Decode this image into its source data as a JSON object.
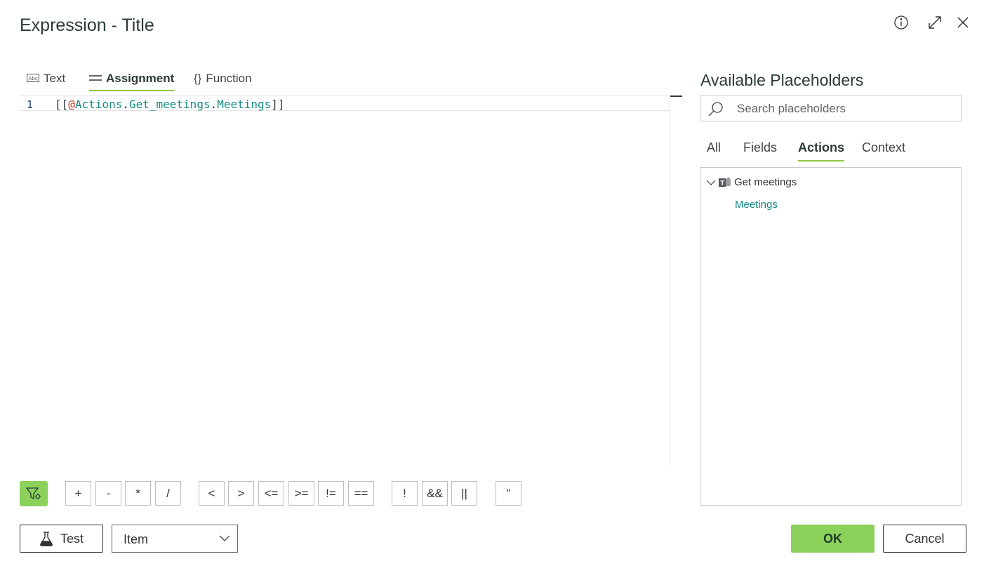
{
  "dialog": {
    "title": "Expression - Title"
  },
  "header_icons": [
    "info-icon",
    "expand-icon",
    "close-icon"
  ],
  "editor_tabs": [
    {
      "label": "Text",
      "icon": "abc-icon"
    },
    {
      "label": "Assignment",
      "icon": "equals-icon",
      "active": true
    },
    {
      "label": "Function",
      "icon": "braces-icon"
    }
  ],
  "editor": {
    "line_number": "1",
    "code": {
      "open": "[[",
      "at": "@",
      "part1": "Actions",
      "dot1": ".",
      "part2": "Get_meetings",
      "dot2": ".",
      "part3": "Meetings",
      "close": "]]"
    }
  },
  "placeholders": {
    "title": "Available Placeholders",
    "search_placeholder": "Search placeholders",
    "tabs": [
      "All",
      "Fields",
      "Actions",
      "Context"
    ],
    "active_tab": "Actions",
    "tree": {
      "node_label": "Get meetings",
      "node_icon": "teams-icon",
      "children": [
        "Meetings"
      ]
    }
  },
  "operators": [
    "+",
    "-",
    "*",
    "/",
    "<",
    ">",
    "<=",
    ">=",
    "!=",
    "==",
    "!",
    "&&",
    "||",
    "\""
  ],
  "footer": {
    "test_label": "Test",
    "context_select_value": "Item",
    "ok_label": "OK",
    "cancel_label": "Cancel"
  },
  "colors": {
    "accent_green": "#8bd15a",
    "placeholder_teal": "#138b83",
    "at_red": "#c0392b"
  }
}
